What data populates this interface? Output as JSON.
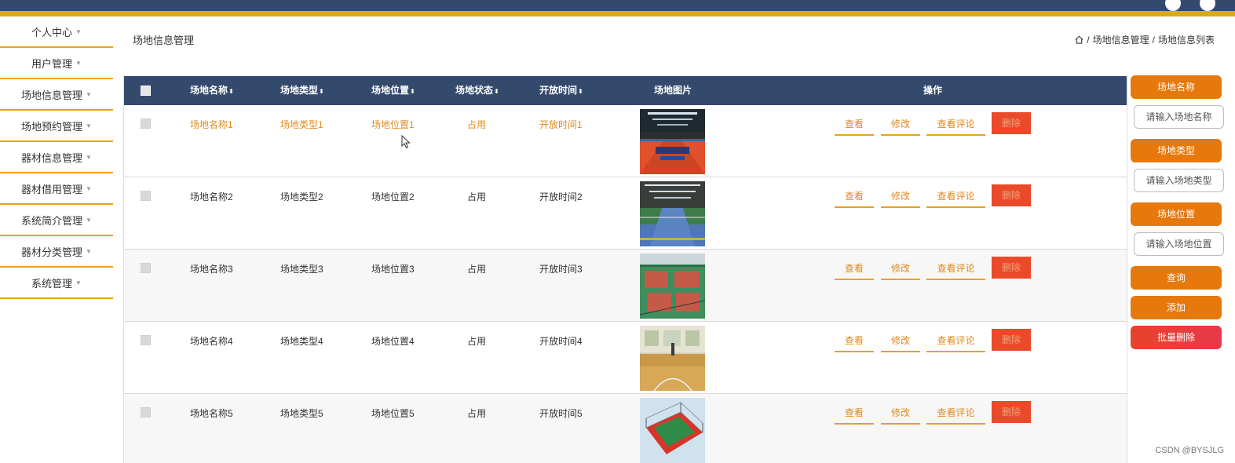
{
  "sidebar": {
    "items": [
      {
        "label": "个人中心"
      },
      {
        "label": "用户管理"
      },
      {
        "label": "场地信息管理"
      },
      {
        "label": "场地预约管理"
      },
      {
        "label": "器材信息管理"
      },
      {
        "label": "器材借用管理"
      },
      {
        "label": "系统简介管理"
      },
      {
        "label": "器材分类管理"
      },
      {
        "label": "系统管理"
      }
    ]
  },
  "page": {
    "title": "场地信息管理",
    "breadcrumb": [
      "场地信息管理",
      "场地信息列表"
    ],
    "breadcrumb_sep": "/"
  },
  "table": {
    "headers": {
      "name": "场地名称",
      "type": "场地类型",
      "location": "场地位置",
      "status": "场地状态",
      "open_time": "开放时间",
      "image": "场地图片",
      "actions": "操作"
    },
    "sort_icon": "sort-icon",
    "rows": [
      {
        "name": "场地名称1",
        "type": "场地类型1",
        "location": "场地位置1",
        "status": "占用",
        "open_time": "开放时间1",
        "image": "table-tennis-hall"
      },
      {
        "name": "场地名称2",
        "type": "场地类型2",
        "location": "场地位置2",
        "status": "占用",
        "open_time": "开放时间2",
        "image": "badminton-hall"
      },
      {
        "name": "场地名称3",
        "type": "场地类型3",
        "location": "场地位置3",
        "status": "占用",
        "open_time": "开放时间3",
        "image": "outdoor-basketball-court"
      },
      {
        "name": "场地名称4",
        "type": "场地类型4",
        "location": "场地位置4",
        "status": "占用",
        "open_time": "开放时间4",
        "image": "indoor-basketball-court"
      },
      {
        "name": "场地名称5",
        "type": "场地类型5",
        "location": "场地位置5",
        "status": "占用",
        "open_time": "开放时间5",
        "image": "fenced-court-3d"
      }
    ],
    "actions": {
      "view": "查看",
      "edit": "修改",
      "comments": "查看评论",
      "delete": "删除"
    }
  },
  "search": {
    "fields": [
      {
        "label": "场地名称",
        "placeholder": "请输入场地名称"
      },
      {
        "label": "场地类型",
        "placeholder": "请输入场地类型"
      },
      {
        "label": "场地位置",
        "placeholder": "请输入场地位置"
      }
    ],
    "query": "查询",
    "add": "添加",
    "batch_delete": "批量删除"
  },
  "watermark": "CSDN @BYSJLG",
  "colors": {
    "topbar": "#344a6c",
    "accent": "#e8a317",
    "button": "#e6780c",
    "danger": "#ea4a2a",
    "link": "#e08a1e"
  }
}
